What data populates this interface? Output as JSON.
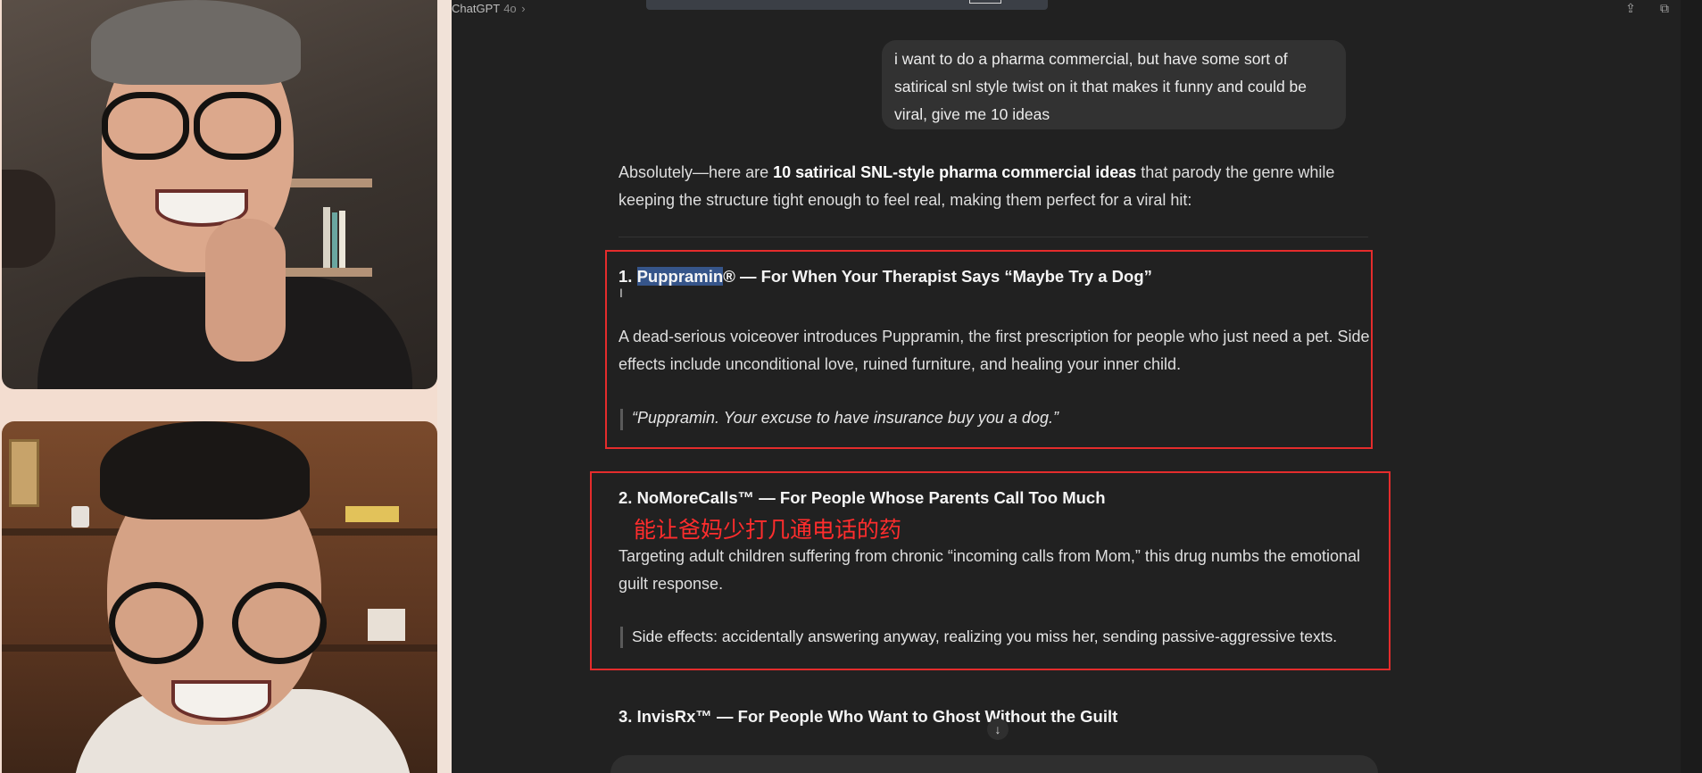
{
  "app": {
    "model_label": "ChatGPT",
    "model_version": "4o",
    "chevron": "›"
  },
  "icons": {
    "share": "share-icon",
    "copy": "copy-icon",
    "scroll_down": "arrow-down-icon"
  },
  "user_message": {
    "text": "i want to do a pharma commercial, but have some sort of satirical snl style twist on it that makes it funny and could be viral, give me 10 ideas"
  },
  "assistant": {
    "intro_prefix": "Absolutely—here are ",
    "intro_bold": "10 satirical SNL-style pharma commercial ideas",
    "intro_suffix": " that parody the genre while keeping the structure tight enough to feel real, making them perfect for a viral hit:"
  },
  "ideas": [
    {
      "number": "1. ",
      "name_highlighted": "Puppramin",
      "title_rest": "® — For When Your Therapist Says “Maybe Try a Dog”",
      "description": "A dead-serious voiceover introduces Puppramin, the first prescription for people who just need a pet. Side effects include unconditional love, ruined furniture, and healing your inner child.",
      "quote": "“Puppramin. Your excuse to have insurance buy you a dog.”"
    },
    {
      "title": "2. NoMoreCalls™ — For People Whose Parents Call Too Much",
      "annotation": "能让爸妈少打几通电话的药",
      "description": "Targeting adult children suffering from chronic “incoming calls from Mom,” this drug numbs the emotional guilt response.",
      "quote": "Side effects: accidentally answering anyway, realizing you miss her, sending passive-aggressive texts."
    },
    {
      "title": "3. InvisRx™ — For People Who Want to Ghost Without the Guilt"
    }
  ],
  "colors": {
    "chat_bg": "#212121",
    "annotation_red": "#e42c2c",
    "selection": "#36558a"
  }
}
